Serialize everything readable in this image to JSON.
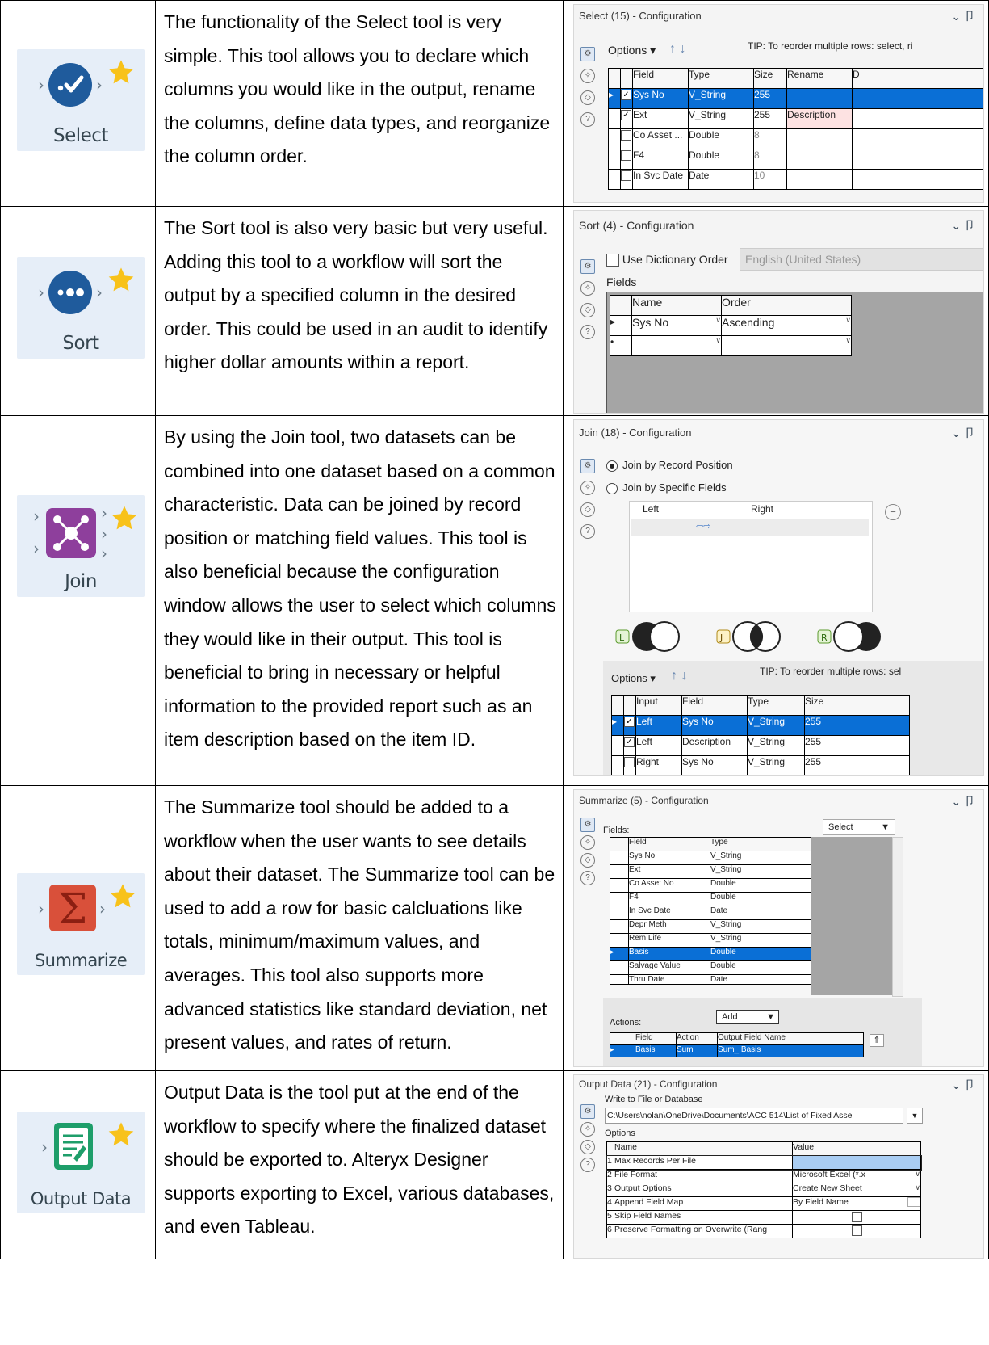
{
  "rows": [
    {
      "tool": "Select",
      "description": "The functionality of the Select tool is very simple. This tool allows you to declare which columns you would like in the output, rename the columns, define data types, and reorganize the column order.",
      "config": {
        "title": "Select (15) - Configuration",
        "options_label": "Options ▾",
        "tip": "TIP: To reorder multiple rows: select, ri",
        "headers": [
          "Field",
          "Type",
          "Size",
          "Rename",
          "D"
        ],
        "rows": [
          {
            "checked": true,
            "field": "Sys No",
            "type": "V_String",
            "size": "255",
            "rename": ""
          },
          {
            "checked": true,
            "field": "Ext",
            "type": "V_String",
            "size": "255",
            "rename": "Description"
          },
          {
            "checked": false,
            "field": "Co Asset ...",
            "type": "Double",
            "size": "8",
            "rename": ""
          },
          {
            "checked": false,
            "field": "F4",
            "type": "Double",
            "size": "8",
            "rename": ""
          },
          {
            "checked": false,
            "field": "In Svc Date",
            "type": "Date",
            "size": "10",
            "rename": ""
          }
        ]
      }
    },
    {
      "tool": "Sort",
      "description": "The Sort tool is also very basic but very useful. Adding this tool to a workflow will sort the output by a specified column in the desired order. This could be used in an audit to identify higher dollar amounts within a report.",
      "config": {
        "title": "Sort (4) - Configuration",
        "dictionary_label": "Use Dictionary Order",
        "locale": "English (United States)",
        "fields_label": "Fields",
        "headers": [
          "Name",
          "Order"
        ],
        "row_name": "Sys No",
        "row_order": "Ascending"
      }
    },
    {
      "tool": "Join",
      "description": "By using the Join tool, two datasets can be combined into one dataset based on a common characteristic. Data can be joined by record position or matching field values. This tool is also beneficial because the configuration window allows the user to select which columns they would like in their output. This tool is beneficial to bring in necessary or helpful information to the provided report such as an item description based on the item ID.",
      "config": {
        "title": "Join (18) - Configuration",
        "radio1": "Join by Record Position",
        "radio2": "Join by Specific Fields",
        "left_label": "Left",
        "right_label": "Right",
        "venn_labels": [
          "L",
          "J",
          "R"
        ],
        "options_label": "Options ▾",
        "tip": "TIP: To reorder multiple rows: sel",
        "headers": [
          "Input",
          "Field",
          "Type",
          "Size"
        ],
        "rows": [
          {
            "checked": true,
            "input": "Left",
            "field": "Sys No",
            "type": "V_String",
            "size": "255"
          },
          {
            "checked": true,
            "input": "Left",
            "field": "Description",
            "type": "V_String",
            "size": "255"
          },
          {
            "checked": false,
            "input": "Right",
            "field": "Sys No",
            "type": "V_String",
            "size": "255"
          }
        ]
      }
    },
    {
      "tool": "Summarize",
      "description": "The Summarize tool should be added to a workflow when the user wants to see details about their dataset. The Summarize tool can be used to add a row for basic calcluations like totals, minimum/maximum values, and averages. This tool also supports more advanced statistics like standard deviation, net present values, and rates of return.",
      "config": {
        "title": "Summarize (5) - Configuration",
        "fields_label": "Fields:",
        "select_label": "Select",
        "headers": [
          "Field",
          "Type"
        ],
        "rows": [
          {
            "field": "Sys No",
            "type": "V_String"
          },
          {
            "field": "Ext",
            "type": "V_String"
          },
          {
            "field": "Co Asset No",
            "type": "Double"
          },
          {
            "field": "F4",
            "type": "Double"
          },
          {
            "field": "In Svc Date",
            "type": "Date"
          },
          {
            "field": "Depr Meth",
            "type": "V_String"
          },
          {
            "field": "Rem Life",
            "type": "V_String"
          },
          {
            "field": "Basis",
            "type": "Double"
          },
          {
            "field": "Salvage Value",
            "type": "Double"
          },
          {
            "field": "Thru Date",
            "type": "Date"
          }
        ],
        "actions_label": "Actions:",
        "add_label": "Add",
        "action_headers": [
          "Field",
          "Action",
          "Output Field Name"
        ],
        "action_row": {
          "field": "Basis",
          "action": "Sum",
          "output": "Sum_ Basis"
        }
      }
    },
    {
      "tool": "Output Data",
      "description": "Output Data is the tool put at the end of the workflow to specify where the finalized dataset should be exported to. Alteryx Designer supports exporting to Excel, various databases, and even Tableau.",
      "config": {
        "title": "Output Data (21) - Configuration",
        "write_label": "Write to File or Database",
        "path": "C:\\Users\\nolan\\OneDrive\\Documents\\ACC 514\\List of Fixed Asse",
        "options_label": "Options",
        "headers": [
          "Name",
          "Value"
        ],
        "rows": [
          {
            "num": "1",
            "name": "Max Records Per File",
            "value": ""
          },
          {
            "num": "2",
            "name": "File Format",
            "value": "Microsoft Excel (*.x"
          },
          {
            "num": "3",
            "name": "Output Options",
            "value": "Create New Sheet"
          },
          {
            "num": "4",
            "name": "Append Field Map",
            "value": "By Field Name"
          },
          {
            "num": "5",
            "name": "Skip Field Names",
            "value": ""
          },
          {
            "num": "6",
            "name": "Preserve Formatting on Overwrite (Rang",
            "value": ""
          }
        ]
      }
    }
  ]
}
